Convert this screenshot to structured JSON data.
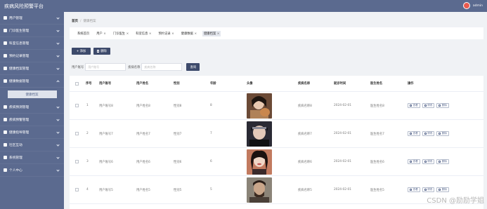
{
  "app": {
    "title": "疾病风险预警平台",
    "username": "admin"
  },
  "sidebar": {
    "items": [
      {
        "label": "用户管理",
        "icon": "user-icon"
      },
      {
        "label": "门诊医生管理",
        "icon": "doctor-icon"
      },
      {
        "label": "科室信息管理",
        "icon": "department-icon"
      },
      {
        "label": "预约记录管理",
        "icon": "calendar-icon"
      },
      {
        "label": "健康档案管理",
        "icon": "file-icon"
      },
      {
        "label": "健康数据管理",
        "icon": "chart-icon"
      }
    ],
    "submenu_label": "健康档案",
    "items_after": [
      {
        "label": "疾病预测管理",
        "icon": "predict-icon"
      },
      {
        "label": "疾病预警管理",
        "icon": "alert-icon"
      },
      {
        "label": "健康指导管理",
        "icon": "guide-icon"
      },
      {
        "label": "社区互动",
        "icon": "community-icon"
      },
      {
        "label": "系统管理",
        "icon": "settings-icon"
      },
      {
        "label": "个人中心",
        "icon": "profile-icon"
      }
    ]
  },
  "breadcrumb": {
    "home": "首页",
    "current": "健康档案"
  },
  "tags": [
    {
      "label": "系统首页",
      "close": ""
    },
    {
      "label": "用户",
      "close": "×"
    },
    {
      "label": "门诊医生",
      "close": "×"
    },
    {
      "label": "科室信息",
      "close": "×"
    },
    {
      "label": "预约记录",
      "close": "×"
    },
    {
      "label": "健康数据",
      "close": "×"
    },
    {
      "label": "健康档案",
      "close": "×"
    }
  ],
  "toolbar": {
    "add_label": "+ 添加",
    "delete_label": "删除"
  },
  "search": {
    "account_label": "用户账号",
    "account_placeholder": "用户账号",
    "name_label": "疾病名称",
    "name_placeholder": "疾病名称",
    "button_label": "查询"
  },
  "table": {
    "columns": [
      "序号",
      "用户账号",
      "用户姓名",
      "性别",
      "年龄",
      "头像",
      "疾病名称",
      "就诊时间",
      "医生姓名",
      "操作"
    ],
    "rows": [
      {
        "index": "1",
        "account": "用户账号8",
        "name": "用户姓名8",
        "gender": "性别8",
        "age": "8",
        "disease": "疾病名称8",
        "date": "2024-02-01",
        "doctor": "医生姓名8"
      },
      {
        "index": "2",
        "account": "用户账号7",
        "name": "用户姓名7",
        "gender": "性别7",
        "age": "7",
        "disease": "疾病名称7",
        "date": "2024-02-01",
        "doctor": "医生姓名7"
      },
      {
        "index": "3",
        "account": "用户账号6",
        "name": "用户姓名6",
        "gender": "性别6",
        "age": "6",
        "disease": "疾病名称6",
        "date": "2024-02-01",
        "doctor": "医生姓名6"
      },
      {
        "index": "4",
        "account": "用户账号5",
        "name": "用户姓名5",
        "gender": "性别5",
        "age": "5",
        "disease": "疾病名称5",
        "date": "2024-02-01",
        "doctor": "医生姓名5"
      }
    ],
    "actions": {
      "view": "查看",
      "edit": "修改",
      "delete": "删除"
    }
  },
  "watermark": "CSDN @励励学姐",
  "colors": {
    "sidebar": "#5b6a8f",
    "accent": "#3d4a6b"
  }
}
